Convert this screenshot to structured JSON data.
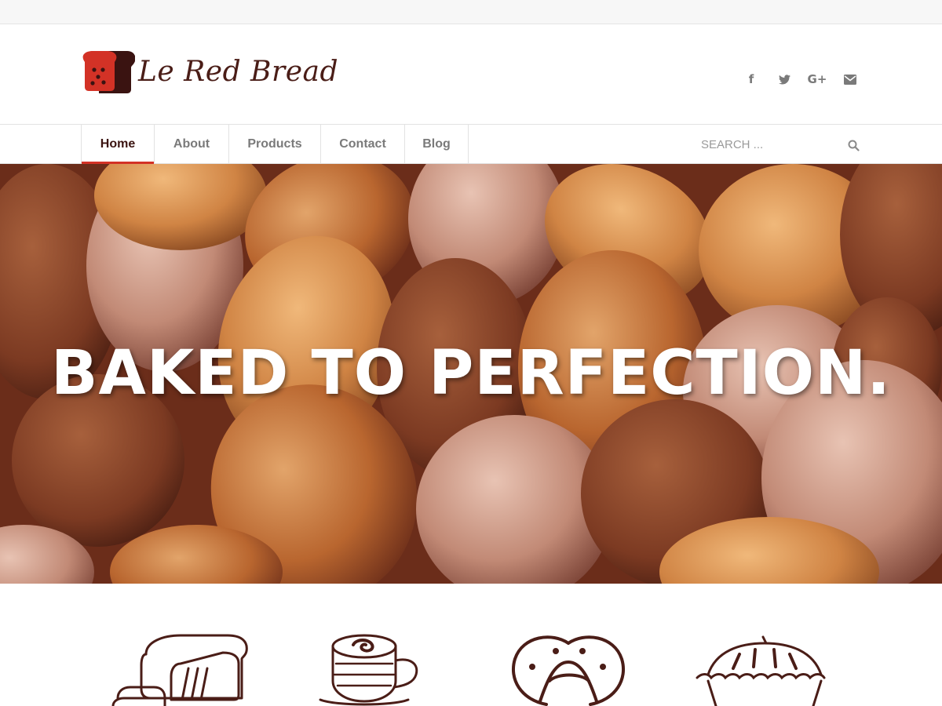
{
  "brand": {
    "name": "Le Red Bread",
    "colors": {
      "accent": "#d33226",
      "brand_dark": "#4a1d17",
      "icon_grey": "#7a7a7a"
    }
  },
  "social": [
    {
      "icon": "facebook-icon",
      "glyph": "f"
    },
    {
      "icon": "twitter-icon",
      "glyph": "🐦"
    },
    {
      "icon": "google-plus-icon",
      "glyph": "G+"
    },
    {
      "icon": "envelope-icon",
      "glyph": "✉"
    }
  ],
  "nav": {
    "items": [
      {
        "label": "Home",
        "active": true
      },
      {
        "label": "About",
        "active": false
      },
      {
        "label": "Products",
        "active": false
      },
      {
        "label": "Contact",
        "active": false
      },
      {
        "label": "Blog",
        "active": false
      }
    ]
  },
  "search": {
    "placeholder": "SEARCH ...",
    "value": "",
    "icon": "search-icon"
  },
  "hero": {
    "title": "BAKED TO PERFECTION."
  },
  "features": [
    {
      "icon": "bread-loaf-icon"
    },
    {
      "icon": "coffee-cup-icon"
    },
    {
      "icon": "pretzel-icon"
    },
    {
      "icon": "pie-icon"
    }
  ]
}
